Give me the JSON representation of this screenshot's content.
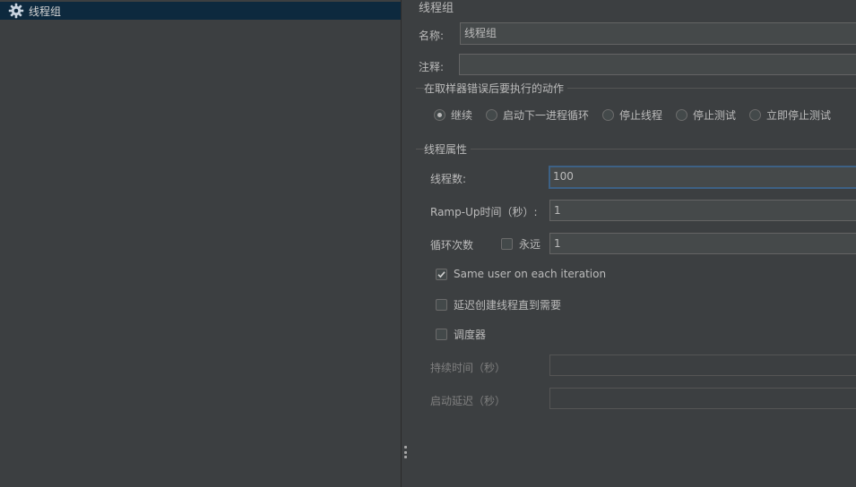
{
  "tree": {
    "items": [
      {
        "label": "线程组",
        "icon": "gear-icon",
        "selected": true
      }
    ]
  },
  "form": {
    "title": "线程组",
    "name_label": "名称:",
    "name_value": "线程组",
    "comment_label": "注释:",
    "comment_value": "",
    "error_action": {
      "group_title": "在取样器错误后要执行的动作",
      "options": [
        {
          "label": "继续",
          "selected": true
        },
        {
          "label": "启动下一进程循环",
          "selected": false
        },
        {
          "label": "停止线程",
          "selected": false
        },
        {
          "label": "停止测试",
          "selected": false
        },
        {
          "label": "立即停止测试",
          "selected": false
        }
      ]
    },
    "thread_props": {
      "group_title": "线程属性",
      "threads_label": "线程数:",
      "threads_value": "100",
      "rampup_label": "Ramp-Up时间（秒）:",
      "rampup_value": "1",
      "loop_label": "循环次数",
      "forever_label": "永远",
      "forever_checked": false,
      "loop_value": "1",
      "same_user_label": "Same user on each iteration",
      "same_user_checked": true,
      "delay_create_label": "延迟创建线程直到需要",
      "delay_create_checked": false,
      "scheduler_label": "调度器",
      "scheduler_checked": false,
      "duration_label": "持续时间（秒）",
      "duration_value": "",
      "startup_delay_label": "启动延迟（秒）",
      "startup_delay_value": ""
    }
  },
  "colors": {
    "background": "#3c3f41",
    "selection": "#0d293e",
    "focus_border": "#3d6185",
    "text": "#bbbbbb"
  }
}
